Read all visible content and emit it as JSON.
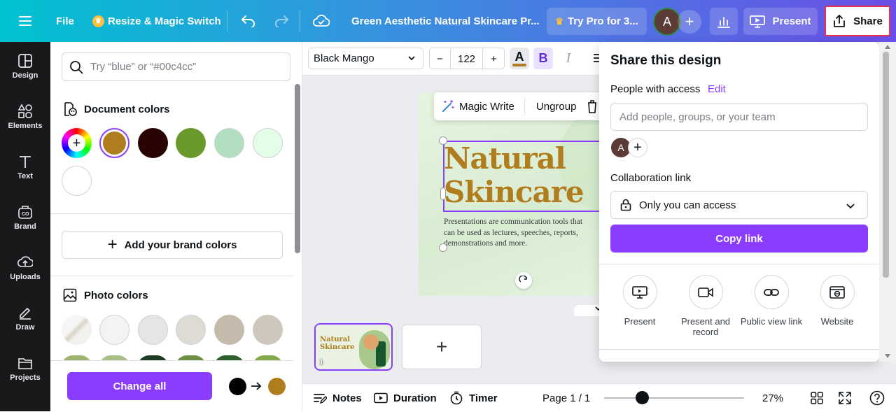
{
  "topbar": {
    "file": "File",
    "resize": "Resize & Magic Switch",
    "doc_title": "Green Aesthetic Natural Skincare Pr...",
    "try_pro": "Try Pro for 3...",
    "avatar": "A",
    "present": "Present",
    "share": "Share"
  },
  "rail": [
    {
      "label": "Design",
      "icon": "design-icon"
    },
    {
      "label": "Elements",
      "icon": "elements-icon"
    },
    {
      "label": "Text",
      "icon": "text-icon"
    },
    {
      "label": "Brand",
      "icon": "brand-icon"
    },
    {
      "label": "Uploads",
      "icon": "uploads-icon"
    },
    {
      "label": "Draw",
      "icon": "draw-icon"
    },
    {
      "label": "Projects",
      "icon": "projects-icon"
    }
  ],
  "panel": {
    "search_placeholder": "Try “blue” or “#00c4cc”",
    "document_colors": "Document colors",
    "doc_swatches": [
      "#b07d1e",
      "#2a0305",
      "#6a9a2b",
      "#b2dfc0",
      "#e3fde6",
      "#ffffff"
    ],
    "add_brand": "Add your brand colors",
    "photo_colors": "Photo colors",
    "photo_swatches": [
      "#f3f3f3",
      "#e6e5e3",
      "#dedbd5",
      "#c5bbac",
      "#cdc7be"
    ],
    "change_all": "Change all",
    "from_color": "#000000",
    "to_color": "#b07d1e"
  },
  "format": {
    "font": "Black Mango",
    "size": "122",
    "minus": "−",
    "plus": "+",
    "bold": "B",
    "italic": "I",
    "text_color": "#b07d1e"
  },
  "floating": {
    "magic_write": "Magic Write",
    "ungroup": "Ungroup"
  },
  "slide": {
    "title_line1": "Natural",
    "title_line2": "Skincare",
    "body": "Presentations are communication tools that can be used as lectures, speeches, reports, demonstrations and more."
  },
  "thumb": {
    "title": "Natural Skincare",
    "number": "1"
  },
  "bottom": {
    "notes": "Notes",
    "duration": "Duration",
    "timer": "Timer",
    "page": "Page 1 / 1",
    "zoom": "27%",
    "zoom_level": 0.27
  },
  "share": {
    "title": "Share this design",
    "people_label": "People with access",
    "edit": "Edit",
    "add_placeholder": "Add people, groups, or your team",
    "avatar": "A",
    "collab_label": "Collaboration link",
    "access": "Only you can access",
    "copy": "Copy link",
    "options": [
      {
        "label": "Present",
        "icon": "present-icon"
      },
      {
        "label": "Present and record",
        "icon": "record-icon"
      },
      {
        "label": "Public view link",
        "icon": "link-icon"
      },
      {
        "label": "Website",
        "icon": "website-icon"
      }
    ]
  },
  "colors": {
    "accent": "#8b3dff",
    "share_highlight": "#e2334f"
  }
}
